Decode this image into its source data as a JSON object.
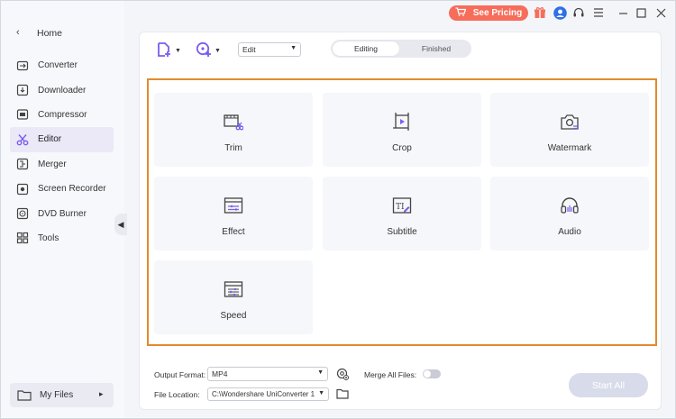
{
  "titlebar": {
    "pricing_label": "See Pricing",
    "icons": [
      "gift-icon",
      "user-avatar-icon",
      "support-icon",
      "menu-icon",
      "minimize-icon",
      "maximize-icon",
      "close-icon"
    ],
    "accent": "#f76d5b"
  },
  "sidebar": {
    "home_label": "Home",
    "items": [
      {
        "label": "Converter",
        "icon": "converter-icon"
      },
      {
        "label": "Downloader",
        "icon": "downloader-icon"
      },
      {
        "label": "Compressor",
        "icon": "compressor-icon"
      },
      {
        "label": "Editor",
        "icon": "editor-scissors-icon",
        "active": true
      },
      {
        "label": "Merger",
        "icon": "merger-icon"
      },
      {
        "label": "Screen Recorder",
        "icon": "screen-recorder-icon"
      },
      {
        "label": "DVD Burner",
        "icon": "dvd-icon"
      },
      {
        "label": "Tools",
        "icon": "tools-grid-icon"
      }
    ],
    "my_files_label": "My Files",
    "active_color": "#7b5cf0"
  },
  "toolbar": {
    "mode_select": "Edit",
    "tabs": [
      {
        "label": "Editing",
        "active": true
      },
      {
        "label": "Finished",
        "active": false
      }
    ]
  },
  "editor": {
    "highlight_color": "#e28b2d",
    "tools": [
      {
        "label": "Trim",
        "icon": "trim-icon"
      },
      {
        "label": "Crop",
        "icon": "crop-icon"
      },
      {
        "label": "Watermark",
        "icon": "watermark-icon"
      },
      {
        "label": "Effect",
        "icon": "effect-icon"
      },
      {
        "label": "Subtitle",
        "icon": "subtitle-icon"
      },
      {
        "label": "Audio",
        "icon": "audio-headphones-icon"
      },
      {
        "label": "Speed",
        "icon": "speed-icon"
      }
    ]
  },
  "footer": {
    "output_format_label": "Output Format:",
    "output_format_value": "MP4",
    "merge_label": "Merge All Files:",
    "merge_enabled": false,
    "file_location_label": "File Location:",
    "file_location_value": "C:\\Wondershare UniConverter 1",
    "start_all_label": "Start All"
  }
}
